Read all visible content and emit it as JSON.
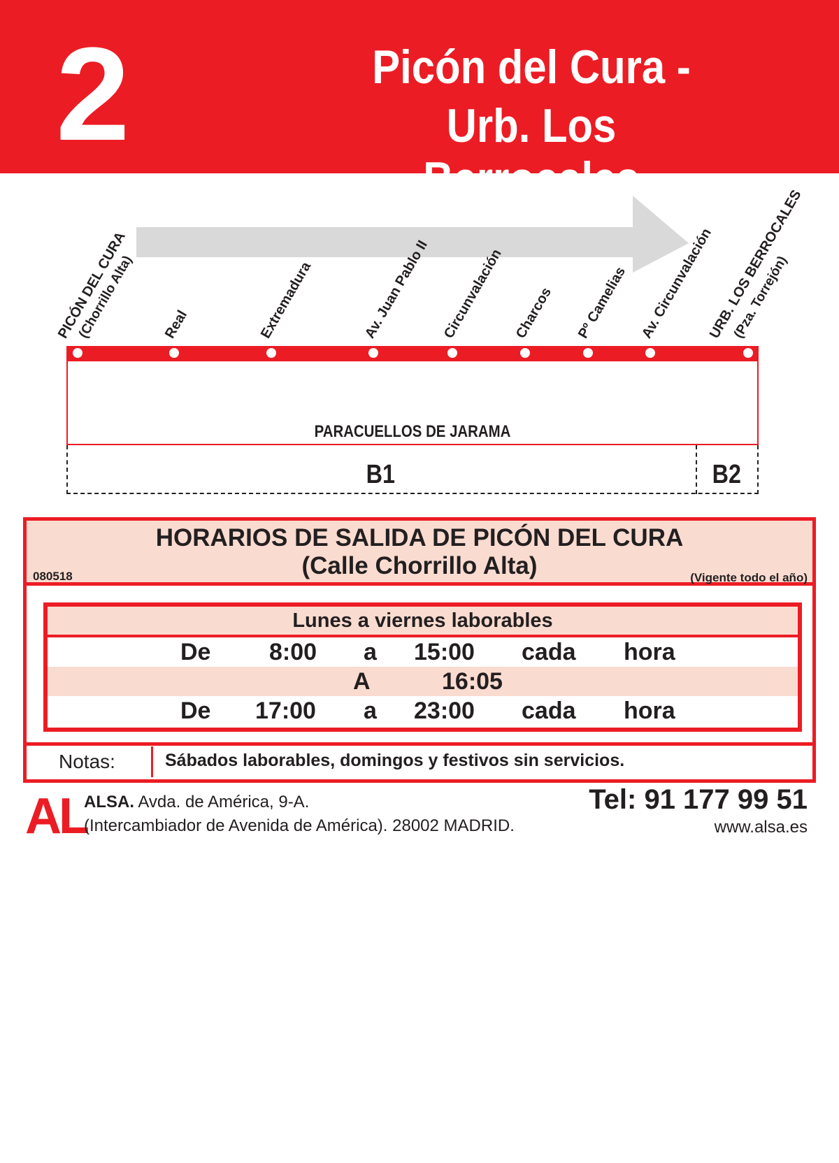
{
  "header": {
    "route_number": "2",
    "title_line1": "Picón del Cura -",
    "title_line2": "Urb. Los Berrocales",
    "color": "#ec1c24"
  },
  "stops": [
    {
      "name": "PICÓN DEL CURA",
      "sub": "(Chorrillo Alta)"
    },
    {
      "name": "Real",
      "sub": ""
    },
    {
      "name": "Extremadura",
      "sub": ""
    },
    {
      "name": "Av. Juan Pablo II",
      "sub": ""
    },
    {
      "name": "Circunvalación",
      "sub": ""
    },
    {
      "name": "Charcos",
      "sub": ""
    },
    {
      "name": "Pº Camelias",
      "sub": ""
    },
    {
      "name": "Av. Circunvalación",
      "sub": ""
    },
    {
      "name": "URB. LOS BERROCALES",
      "sub": "(Pza. Torrejón)"
    }
  ],
  "zone": {
    "label": "PARACUELLOS DE JARAMA",
    "b1": "B1",
    "b2": "B2"
  },
  "schedule": {
    "heading_line1": "HORARIOS DE SALIDA DE PICÓN DEL CURA",
    "heading_line2": "(Calle Chorrillo Alta)",
    "code": "080518",
    "validity": "(Vigente todo el año)",
    "days_title": "Lunes a viernes laborables",
    "rows": [
      {
        "c1": "De",
        "c2": "8:00",
        "c3": "a",
        "c4": "15:00",
        "c5": "cada",
        "c6": "hora"
      },
      {
        "c1": "",
        "c2": "",
        "c3": "A",
        "c4": "16:05",
        "c5": "",
        "c6": ""
      },
      {
        "c1": "De",
        "c2": "17:00",
        "c3": "a",
        "c4": "23:00",
        "c5": "cada",
        "c6": "hora"
      }
    ],
    "notes_label": "Notas:",
    "notes_text": "Sábados laborables, domingos y festivos sin servicios."
  },
  "footer": {
    "logo": "AL",
    "company": "ALSA.",
    "address1": " Avda. de América, 9-A.",
    "address2": "(Intercambiador de Avenida de América). 28002 MADRID.",
    "phone": "Tel: 91 177 99 51",
    "website": "www.alsa.es"
  },
  "colors": {
    "brand_red": "#ec1c24",
    "pale_pink": "#fadbd0",
    "arrow_gray": "#d9d9d9"
  },
  "icons": [
    "direction-arrow-icon"
  ]
}
